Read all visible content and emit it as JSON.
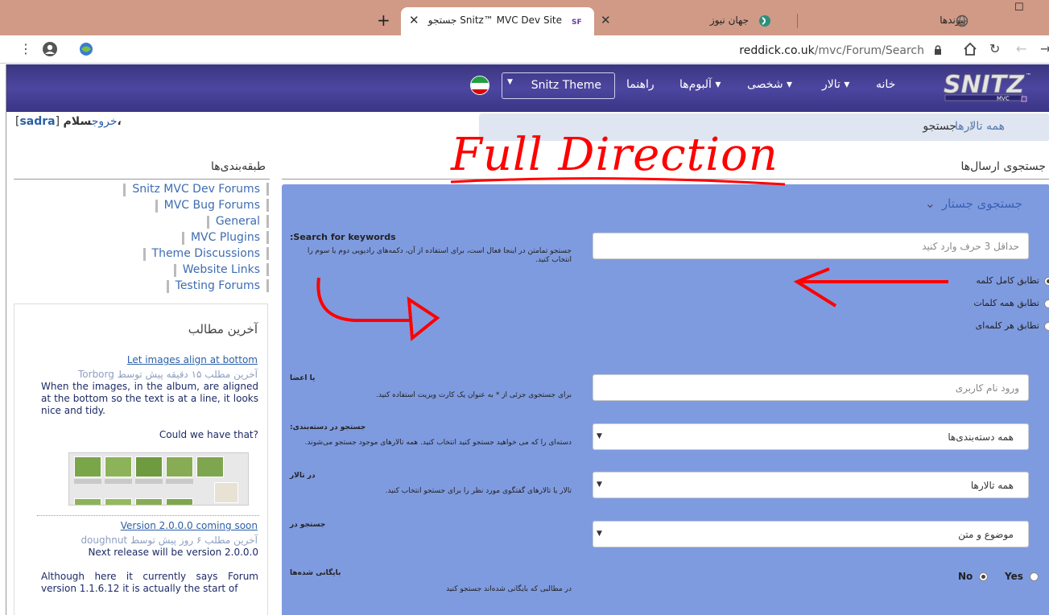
{
  "browser": {
    "tabs": [
      {
        "title": "جستجو Snitz™ MVC Dev Site",
        "favicon": "snitz-favicon"
      },
      {
        "title": "جهان نیوز",
        "favicon": "news-favicon"
      },
      {
        "title": "پیوندها",
        "favicon": "globe-favicon"
      }
    ],
    "url_host": "reddick.co.uk",
    "url_path": "/mvc/Forum/Search"
  },
  "nav": {
    "logo_text": "SNITZ",
    "logo_sub": "MVC",
    "items": [
      {
        "label": "خانه"
      },
      {
        "label": "تالار ▾"
      },
      {
        "label": "شخصی ▾"
      },
      {
        "label": "آلبوم‌ها ▾"
      },
      {
        "label": "راهنما"
      }
    ],
    "theme_label": "Snitz Theme"
  },
  "breadcrumb": {
    "home": "همه تالارها",
    "separator": "/",
    "current": "جستجو"
  },
  "greeting": {
    "hello": "سلام،",
    "logout": "خروج",
    "user": "sadra"
  },
  "sidebar": {
    "categories_title": "طبقه‌بندی‌ها",
    "categories": [
      "Snitz MVC Dev Forums",
      "MVC Bug Forums",
      "General",
      "MVC Plugins",
      "Theme Discussions",
      "Website Links",
      "Testing Forums"
    ],
    "latest_title": "آخرین مطالب",
    "posts": [
      {
        "title": "Let images align at bottom",
        "meta": "آخرین مطلب ۱۵ دقیقه پیش توسط Torborg",
        "body": "When the images, in the album, are aligned at the bottom so the text is at a line, it looks nice and tidy.",
        "body2": "Could we have that?"
      },
      {
        "title": "Version 2.0.0.0 coming soon",
        "meta": "آخرین مطلب ۶ روز پیش توسط doughnut",
        "body": "Next release will be version 2.0.0.0",
        "body2": "Although here it currently says Forum version 1.1.6.12 it is actually the start of"
      }
    ]
  },
  "search": {
    "section_title": "جستجوی ارسال‌ها",
    "panel_title": "جستجوی جستار",
    "keywords": {
      "label": "Search for keywords:",
      "help": "جستجو تمامتن در اینجا فعال است، برای استفاده از آن، دکمه‌های رادیویی دوم یا سوم را انتخاب کنید.",
      "placeholder": "حداقل 3 حرف وارد کنید"
    },
    "match_options": [
      {
        "label": "تطابق کامل کلمه",
        "selected": true
      },
      {
        "label": "تطابق همه کلمات",
        "selected": false
      },
      {
        "label": "تطابق هر کلمه‌ای",
        "selected": false
      }
    ],
    "member": {
      "label": "یا اعضا",
      "help": "برای جستجوی جزئی از * به عنوان یک کارت ویزیت استفاده کنید.",
      "placeholder": "ورود نام کاربری"
    },
    "category": {
      "label": "جستجو در دسته‌بندی:",
      "help": "دسته‌ای را که می خواهید جستجو کنید انتخاب کنید. همه تالارهای موجود جستجو می‌شوند.",
      "value": "همه دسته‌بندی‌ها"
    },
    "forum": {
      "label": "در تالار",
      "help": "تالار یا تالارهای گفتگوی مورد نظر را برای جستجو انتخاب کنید.",
      "value": "همه تالارها"
    },
    "search_in": {
      "label": "جستجو در",
      "value": "موضوع و متن"
    },
    "archived": {
      "label": "بایگانی شده‌ها",
      "help": "در مطالبی که بایگانی شده‌اند جستجو کنید",
      "no": "No",
      "yes": "Yes",
      "selected": "No"
    }
  },
  "annotation": {
    "text": "Full Direction",
    "color": "#ff0000"
  },
  "colors": {
    "navbar": "#3f3a8a",
    "panel": "#7f9be0",
    "tabstrip": "#d09a86",
    "link": "#3d6cb2"
  }
}
